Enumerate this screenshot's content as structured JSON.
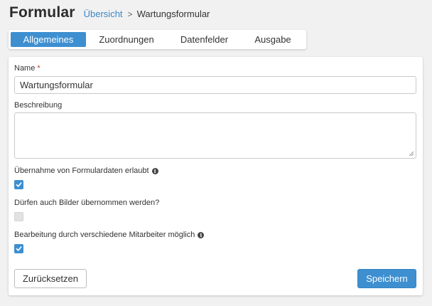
{
  "header": {
    "title": "Formular",
    "breadcrumb": {
      "link": "Übersicht",
      "separator": ">",
      "current": "Wartungsformular"
    }
  },
  "tabs": [
    {
      "label": "Allgemeines",
      "active": true
    },
    {
      "label": "Zuordnungen",
      "active": false
    },
    {
      "label": "Datenfelder",
      "active": false
    },
    {
      "label": "Ausgabe",
      "active": false
    }
  ],
  "form": {
    "name": {
      "label": "Name",
      "required_marker": "*",
      "value": "Wartungsformular"
    },
    "description": {
      "label": "Beschreibung",
      "value": ""
    },
    "options": [
      {
        "label": "Übernahme von Formulardaten erlaubt",
        "checked": true,
        "info_icon": "info-circle-icon"
      },
      {
        "label": "Dürfen auch Bilder übernommen werden?",
        "checked": false,
        "disabled": true
      },
      {
        "label": "Bearbeitung durch verschiedene Mitarbeiter möglich",
        "checked": true,
        "info_icon": "info-circle-icon"
      }
    ]
  },
  "actions": {
    "reset_label": "Zurücksetzen",
    "save_label": "Speichern"
  },
  "colors": {
    "accent": "#3d8fd0",
    "link": "#3a87c8",
    "required": "#c0392b",
    "background": "#f1f1f1"
  }
}
